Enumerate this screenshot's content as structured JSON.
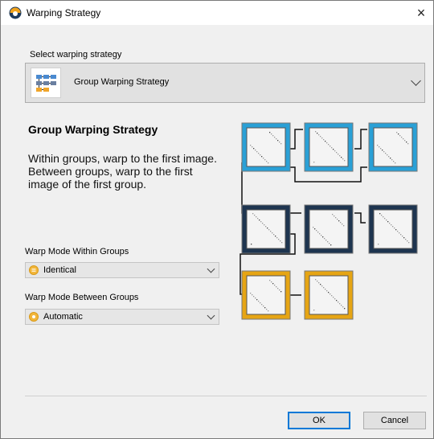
{
  "window": {
    "title": "Warping Strategy",
    "close_glyph": "×"
  },
  "strategy": {
    "label": "Select warping strategy",
    "selected": "Group Warping Strategy",
    "icon": "group-strategy-icon"
  },
  "description": {
    "heading": "Group Warping Strategy",
    "text": "Within groups, warp to the first image. Between groups, warp to the first image of the first group."
  },
  "within_groups": {
    "label": "Warp Mode Within Groups",
    "value": "Identical",
    "icon": "identical-mode-icon"
  },
  "between_groups": {
    "label": "Warp Mode Between Groups",
    "value": "Automatic",
    "icon": "automatic-mode-icon"
  },
  "diagram": {
    "groups": [
      {
        "frame_color": "#2aa0d6",
        "count": 3
      },
      {
        "frame_color": "#1e3550",
        "count": 3
      },
      {
        "frame_color": "#e6a514",
        "count": 2
      }
    ]
  },
  "buttons": {
    "ok": "OK",
    "cancel": "Cancel"
  }
}
